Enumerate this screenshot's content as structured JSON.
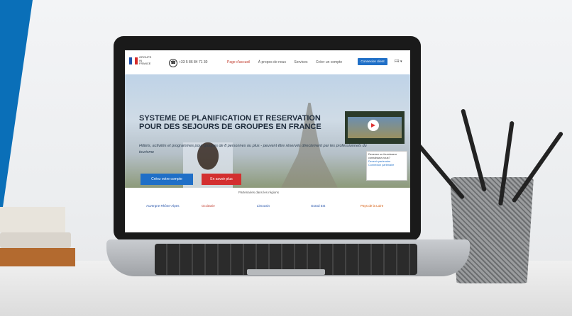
{
  "header": {
    "logo_text": "GROUPS IN FRANCE",
    "phone": "+33 5 86 84 71 30",
    "nav": [
      "Page d'accueil",
      "À propos de nous",
      "Services",
      "Créer un compte"
    ],
    "login_label": "Connexion client",
    "language": "FR ▾"
  },
  "hero": {
    "title": "SYSTEME DE PLANIFICATION ET RESERVATION POUR DES SEJOURS DE GROUPES EN FRANCE",
    "subtitle": "Hôtels, activités et programmes pour groupes de 8 personnes ou plus - peuvent être réservés directement par les professionnels du tourisme",
    "create_account_label": "Créez votre compte",
    "learn_more_label": "En savoir plus",
    "play_icon": "play-icon"
  },
  "partner_box": {
    "text": "Devenez un fournisseur connaissez-nous?",
    "link1": "Devenir partenaire",
    "link2": "Connexion partenaire"
  },
  "partners": {
    "title": "Partenaires dans les régions",
    "logos": [
      "Auvergne Rhône-Alpes",
      "Occitanie",
      "Limousin",
      "Grand Est",
      "Pays de la Loire"
    ]
  },
  "colors": {
    "accent_blue": "#1f6fc7",
    "accent_red": "#d32f2f",
    "brand_blue": "#0a6fb8"
  }
}
